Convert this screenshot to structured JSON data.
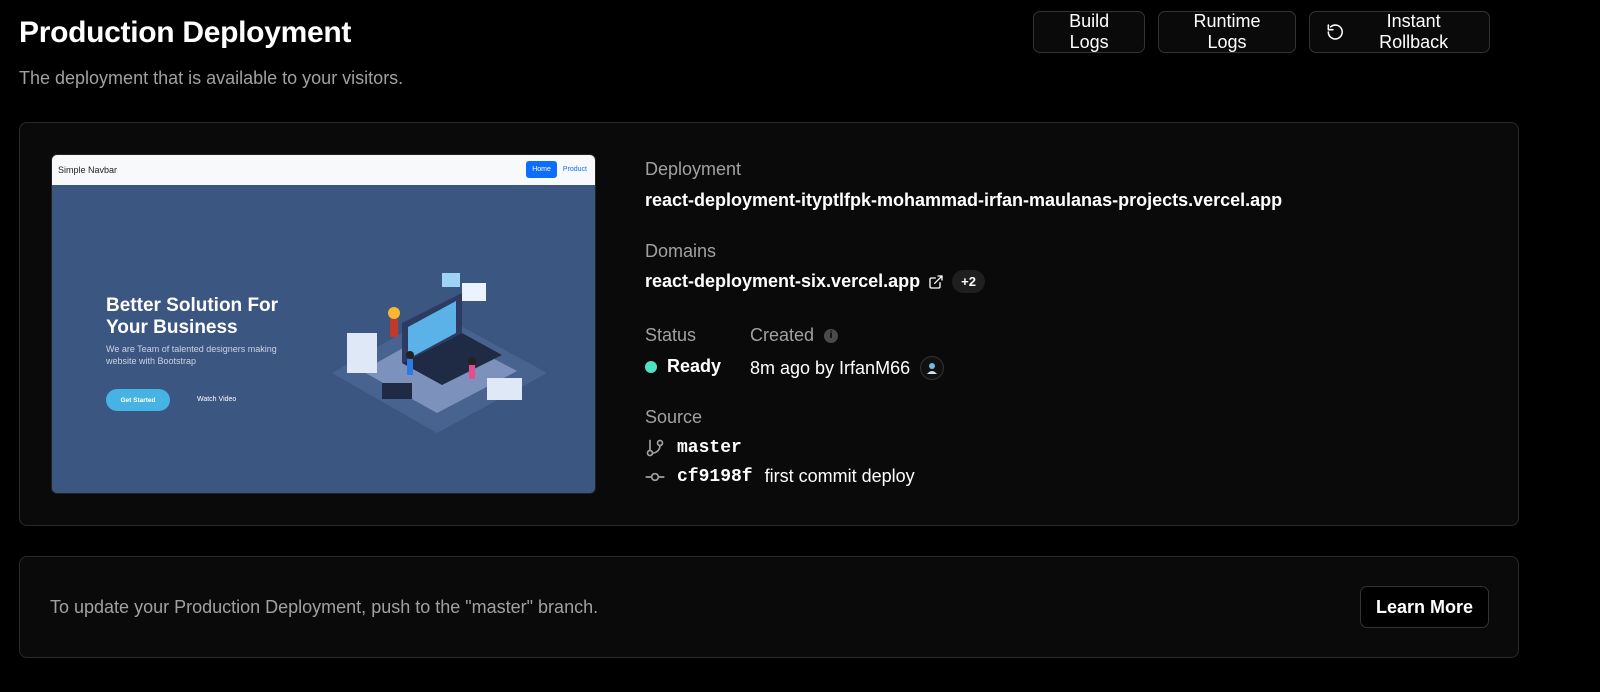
{
  "header": {
    "title": "Production Deployment",
    "subtitle": "The deployment that is available to your visitors.",
    "build_logs": "Build Logs",
    "runtime_logs": "Runtime Logs",
    "instant_rollback": "Instant Rollback"
  },
  "preview": {
    "brand": "Simple Navbar",
    "nav_home": "Home",
    "nav_product": "Product",
    "hero_title": "Better Solution For Your Business",
    "hero_subtitle": "We are Team of talented designers making website with Bootstrap",
    "cta": "Get Started",
    "watch": "Watch Video"
  },
  "deployment": {
    "label": "Deployment",
    "url": "react-deployment-ityptlfpk-mohammad-irfan-maulanas-projects.vercel.app"
  },
  "domains": {
    "label": "Domains",
    "primary": "react-deployment-six.vercel.app",
    "extra_count": "+2"
  },
  "status": {
    "label": "Status",
    "value": "Ready",
    "color": "#50e3c2"
  },
  "created": {
    "label": "Created",
    "value": "8m ago by IrfanM66"
  },
  "source": {
    "label": "Source",
    "branch": "master",
    "commit_hash": "cf9198f",
    "commit_message": "first commit deploy"
  },
  "footer_card": {
    "text": "To update your Production Deployment, push to the \"master\" branch.",
    "learn_more": "Learn More"
  }
}
